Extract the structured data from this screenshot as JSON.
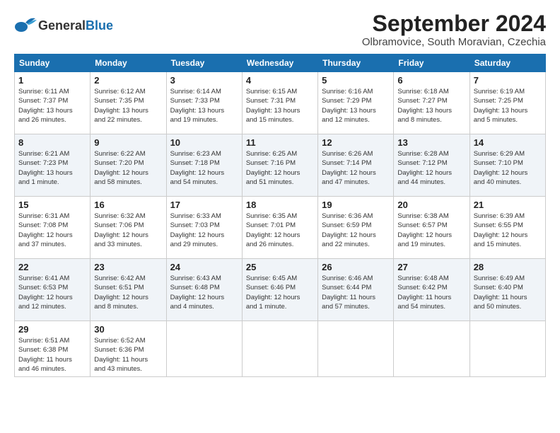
{
  "header": {
    "logo_general": "General",
    "logo_blue": "Blue",
    "month_title": "September 2024",
    "subtitle": "Olbramovice, South Moravian, Czechia"
  },
  "days_of_week": [
    "Sunday",
    "Monday",
    "Tuesday",
    "Wednesday",
    "Thursday",
    "Friday",
    "Saturday"
  ],
  "weeks": [
    [
      {
        "day": 1,
        "info": "Sunrise: 6:11 AM\nSunset: 7:37 PM\nDaylight: 13 hours\nand 26 minutes."
      },
      {
        "day": 2,
        "info": "Sunrise: 6:12 AM\nSunset: 7:35 PM\nDaylight: 13 hours\nand 22 minutes."
      },
      {
        "day": 3,
        "info": "Sunrise: 6:14 AM\nSunset: 7:33 PM\nDaylight: 13 hours\nand 19 minutes."
      },
      {
        "day": 4,
        "info": "Sunrise: 6:15 AM\nSunset: 7:31 PM\nDaylight: 13 hours\nand 15 minutes."
      },
      {
        "day": 5,
        "info": "Sunrise: 6:16 AM\nSunset: 7:29 PM\nDaylight: 13 hours\nand 12 minutes."
      },
      {
        "day": 6,
        "info": "Sunrise: 6:18 AM\nSunset: 7:27 PM\nDaylight: 13 hours\nand 8 minutes."
      },
      {
        "day": 7,
        "info": "Sunrise: 6:19 AM\nSunset: 7:25 PM\nDaylight: 13 hours\nand 5 minutes."
      }
    ],
    [
      {
        "day": 8,
        "info": "Sunrise: 6:21 AM\nSunset: 7:23 PM\nDaylight: 13 hours\nand 1 minute."
      },
      {
        "day": 9,
        "info": "Sunrise: 6:22 AM\nSunset: 7:20 PM\nDaylight: 12 hours\nand 58 minutes."
      },
      {
        "day": 10,
        "info": "Sunrise: 6:23 AM\nSunset: 7:18 PM\nDaylight: 12 hours\nand 54 minutes."
      },
      {
        "day": 11,
        "info": "Sunrise: 6:25 AM\nSunset: 7:16 PM\nDaylight: 12 hours\nand 51 minutes."
      },
      {
        "day": 12,
        "info": "Sunrise: 6:26 AM\nSunset: 7:14 PM\nDaylight: 12 hours\nand 47 minutes."
      },
      {
        "day": 13,
        "info": "Sunrise: 6:28 AM\nSunset: 7:12 PM\nDaylight: 12 hours\nand 44 minutes."
      },
      {
        "day": 14,
        "info": "Sunrise: 6:29 AM\nSunset: 7:10 PM\nDaylight: 12 hours\nand 40 minutes."
      }
    ],
    [
      {
        "day": 15,
        "info": "Sunrise: 6:31 AM\nSunset: 7:08 PM\nDaylight: 12 hours\nand 37 minutes."
      },
      {
        "day": 16,
        "info": "Sunrise: 6:32 AM\nSunset: 7:06 PM\nDaylight: 12 hours\nand 33 minutes."
      },
      {
        "day": 17,
        "info": "Sunrise: 6:33 AM\nSunset: 7:03 PM\nDaylight: 12 hours\nand 29 minutes."
      },
      {
        "day": 18,
        "info": "Sunrise: 6:35 AM\nSunset: 7:01 PM\nDaylight: 12 hours\nand 26 minutes."
      },
      {
        "day": 19,
        "info": "Sunrise: 6:36 AM\nSunset: 6:59 PM\nDaylight: 12 hours\nand 22 minutes."
      },
      {
        "day": 20,
        "info": "Sunrise: 6:38 AM\nSunset: 6:57 PM\nDaylight: 12 hours\nand 19 minutes."
      },
      {
        "day": 21,
        "info": "Sunrise: 6:39 AM\nSunset: 6:55 PM\nDaylight: 12 hours\nand 15 minutes."
      }
    ],
    [
      {
        "day": 22,
        "info": "Sunrise: 6:41 AM\nSunset: 6:53 PM\nDaylight: 12 hours\nand 12 minutes."
      },
      {
        "day": 23,
        "info": "Sunrise: 6:42 AM\nSunset: 6:51 PM\nDaylight: 12 hours\nand 8 minutes."
      },
      {
        "day": 24,
        "info": "Sunrise: 6:43 AM\nSunset: 6:48 PM\nDaylight: 12 hours\nand 4 minutes."
      },
      {
        "day": 25,
        "info": "Sunrise: 6:45 AM\nSunset: 6:46 PM\nDaylight: 12 hours\nand 1 minute."
      },
      {
        "day": 26,
        "info": "Sunrise: 6:46 AM\nSunset: 6:44 PM\nDaylight: 11 hours\nand 57 minutes."
      },
      {
        "day": 27,
        "info": "Sunrise: 6:48 AM\nSunset: 6:42 PM\nDaylight: 11 hours\nand 54 minutes."
      },
      {
        "day": 28,
        "info": "Sunrise: 6:49 AM\nSunset: 6:40 PM\nDaylight: 11 hours\nand 50 minutes."
      }
    ],
    [
      {
        "day": 29,
        "info": "Sunrise: 6:51 AM\nSunset: 6:38 PM\nDaylight: 11 hours\nand 46 minutes."
      },
      {
        "day": 30,
        "info": "Sunrise: 6:52 AM\nSunset: 6:36 PM\nDaylight: 11 hours\nand 43 minutes."
      },
      null,
      null,
      null,
      null,
      null
    ]
  ]
}
